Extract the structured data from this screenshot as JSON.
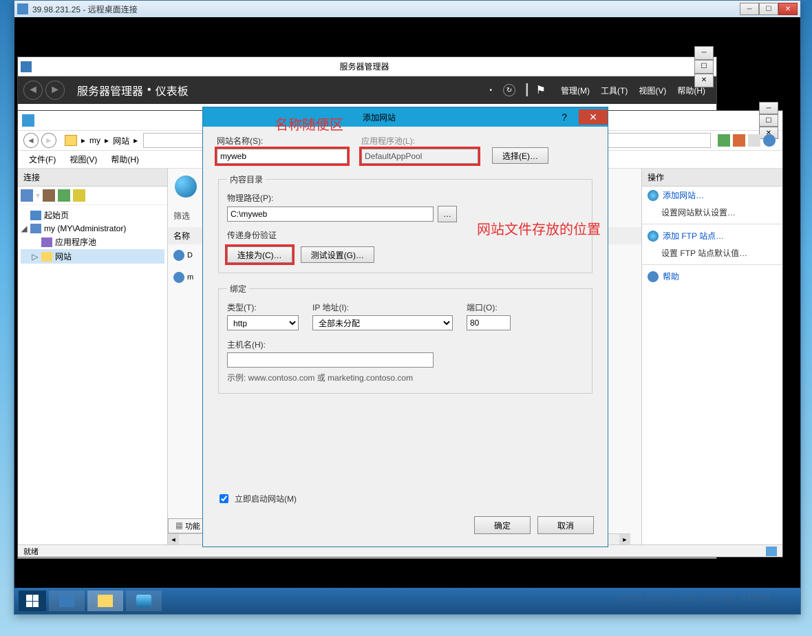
{
  "rdc": {
    "title": "39.98.231.25 - 远程桌面连接"
  },
  "sm": {
    "title": "服务器管理器",
    "breadcrumb1": "服务器管理器",
    "breadcrumb2": "仪表板",
    "menu": {
      "manage": "管理(M)",
      "tools": "工具(T)",
      "view": "视图(V)",
      "help": "帮助(H)"
    }
  },
  "iis": {
    "crumb1": "my",
    "crumb2": "网站",
    "menu": {
      "file": "文件(F)",
      "view": "视图(V)",
      "help": "帮助(H)"
    },
    "left_header": "连接",
    "tree": {
      "start": "起始页",
      "server": "my (MY\\Administrator)",
      "apppools": "应用程序池",
      "sites": "网站"
    },
    "center": {
      "filter": "筛选",
      "colname": "名称",
      "item1": "D",
      "item2": "m",
      "tab1": "功能"
    },
    "right_header": "操作",
    "actions": {
      "addsite": "添加网站…",
      "setdefault": "设置网站默认设置…",
      "addftp": "添加 FTP 站点…",
      "setftpdefault": "设置 FTP 站点默认值…",
      "help": "帮助"
    },
    "status": "就绪"
  },
  "dlg": {
    "title": "添加网站",
    "labels": {
      "sitename": "网站名称(S):",
      "apppool": "应用程序池(L):",
      "select": "选择(E)…",
      "content": "内容目录",
      "physpath": "物理路径(P):",
      "passauth": "传递身份验证",
      "connectas": "连接为(C)…",
      "testset": "测试设置(G)…",
      "binding": "绑定",
      "type": "类型(T):",
      "ip": "IP 地址(I):",
      "port": "端口(O):",
      "hostname": "主机名(H):",
      "example": "示例: www.contoso.com 或 marketing.contoso.com",
      "startnow": "立即启动网站(M)",
      "ok": "确定",
      "cancel": "取消"
    },
    "values": {
      "sitename": "myweb",
      "apppool": "DefaultAppPool",
      "physpath": "C:\\myweb",
      "type": "http",
      "ip": "全部未分配",
      "port": "80",
      "hostname": ""
    }
  },
  "annot": {
    "name": "名称随便区",
    "path": "网站文件存放的位置"
  },
  "watermark": "https://blog.csdn.net/qq_41004"
}
